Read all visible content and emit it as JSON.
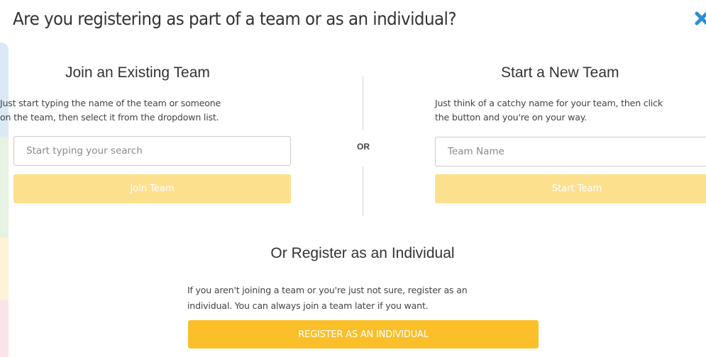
{
  "modal": {
    "title": "Are you registering as part of a team or as an individual?",
    "close_icon": "close-icon",
    "accent_color": "#fbbf2a",
    "light_accent_color": "#fde08e",
    "close_color": "#2a8fd6"
  },
  "join_team": {
    "title": "Join an Existing Team",
    "description_lines": [
      "Just start typing the name of the team or someone",
      "on the team, then select it from the dropdown list."
    ],
    "search_placeholder": "Start typing your search",
    "search_value": "",
    "button_label": "Join Team"
  },
  "separator": {
    "label": "OR"
  },
  "new_team": {
    "title": "Start a New Team",
    "description_lines": [
      "Just think of a catchy name for your team, then click",
      "the button and you're on your way."
    ],
    "name_placeholder": "Team Name",
    "name_value": "",
    "button_label": "Start Team"
  },
  "individual": {
    "title": "Or Register as an Individual",
    "description_lines": [
      "If you aren't joining a team or you're just not sure, register as an",
      "individual. You can always join a team later if you want."
    ],
    "button_label": "REGISTER AS AN INDIVIDUAL"
  }
}
